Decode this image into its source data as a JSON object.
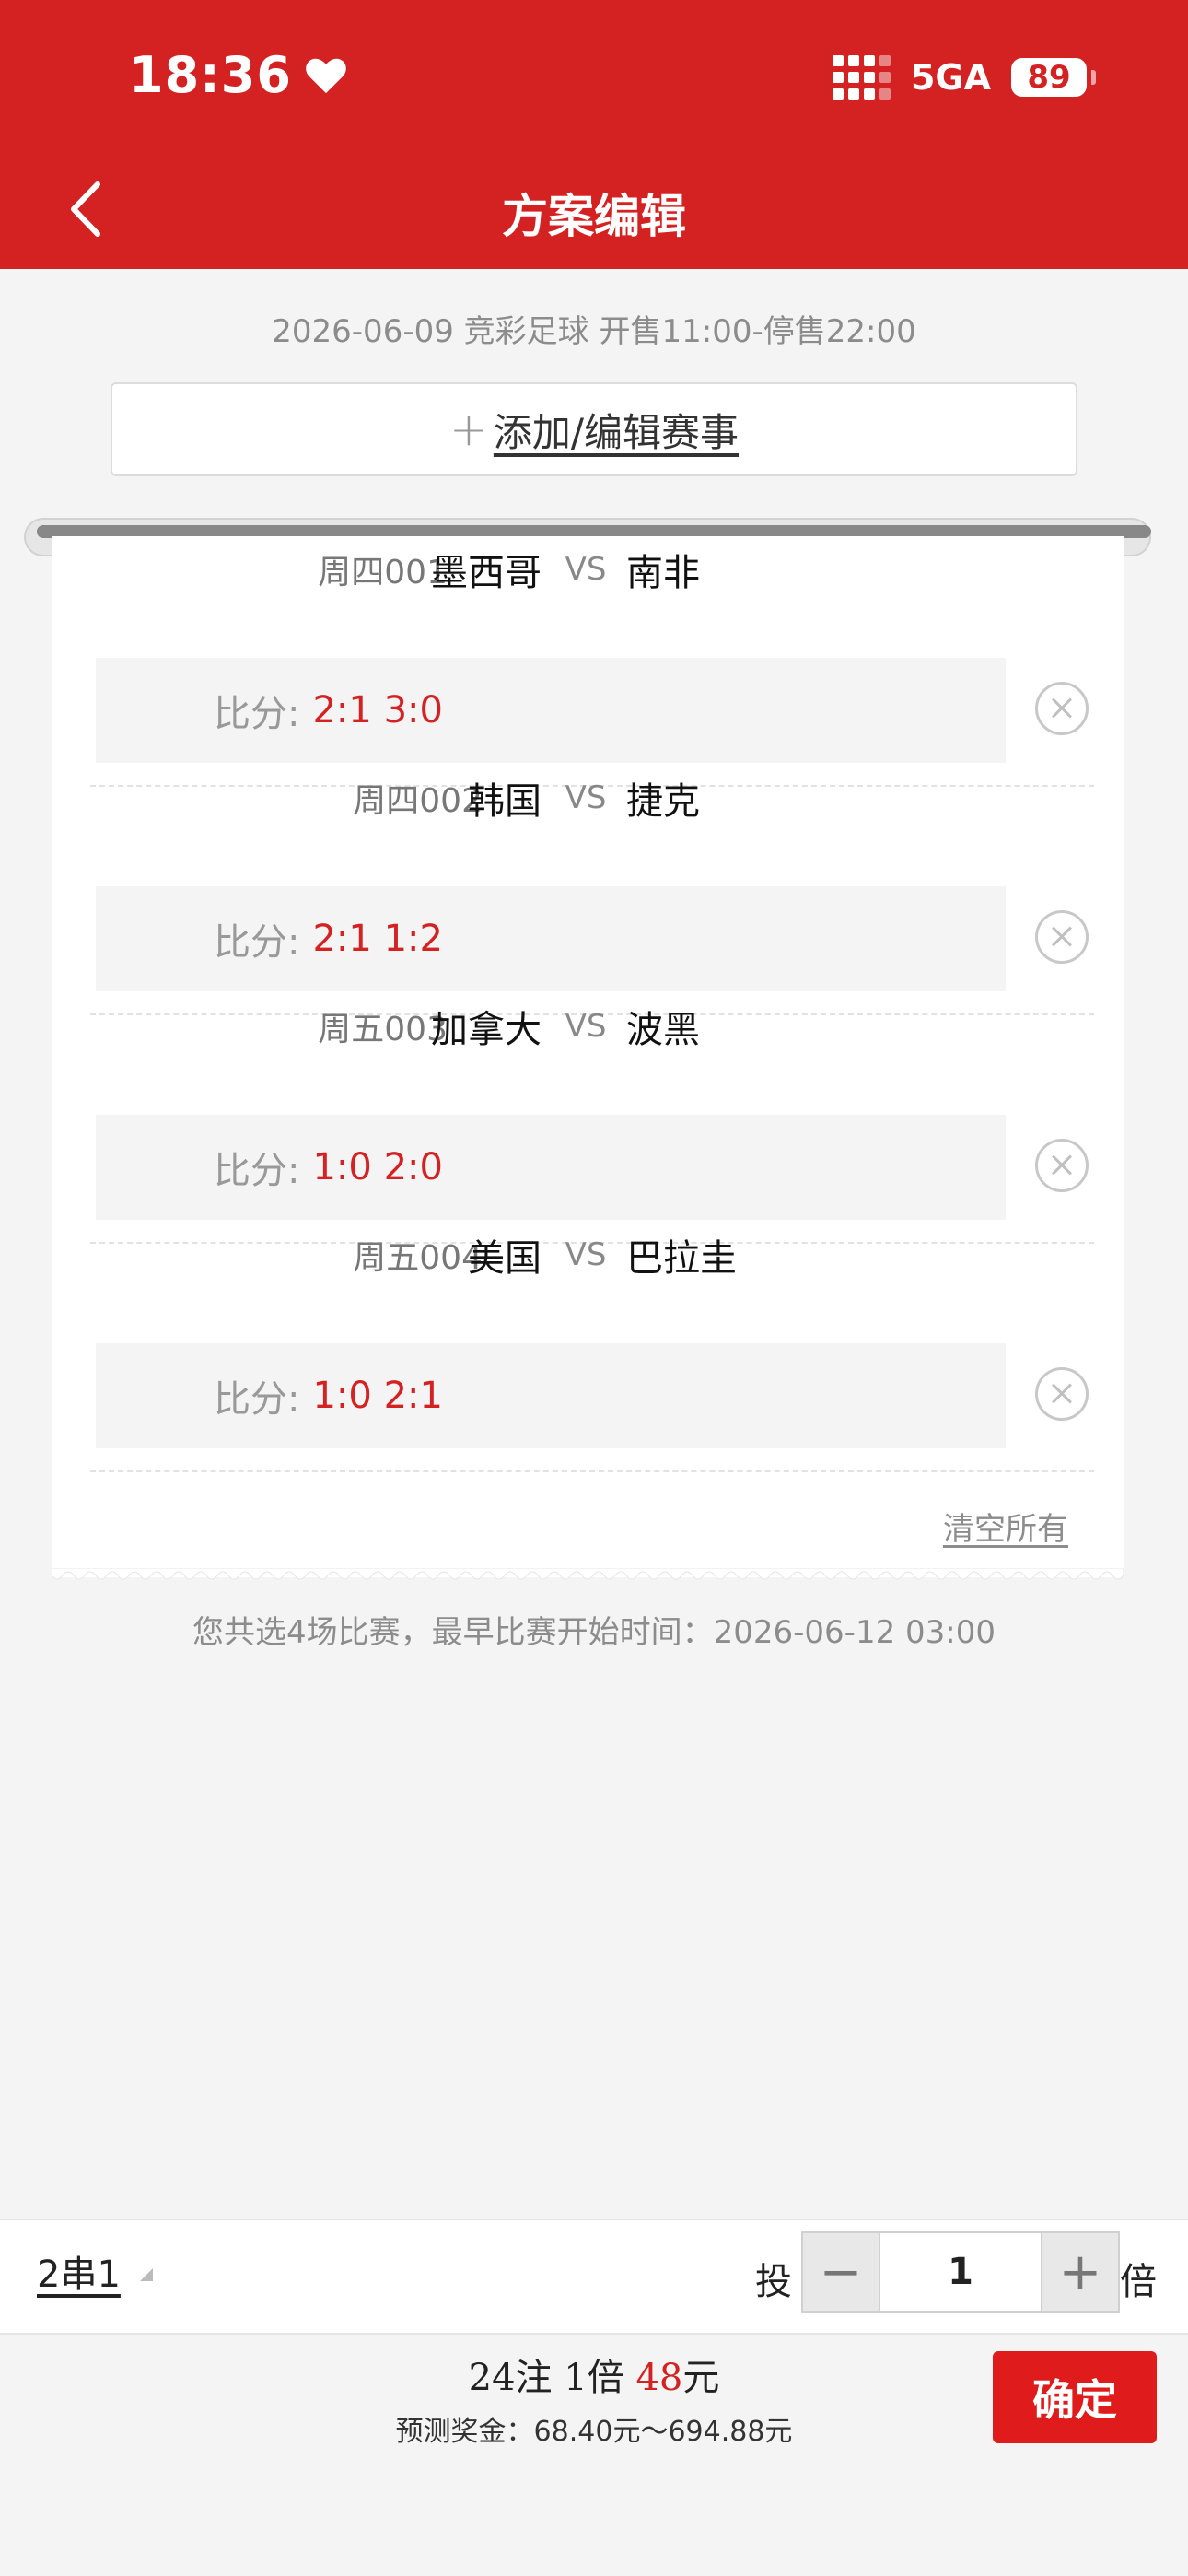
{
  "status_bar": {
    "time": "18:36",
    "network": "5GA",
    "battery": "89"
  },
  "header": {
    "title": "方案编辑"
  },
  "sale_info": "2026-06-09 竞彩足球 开售11:00-停售22:00",
  "add_button": {
    "plus": "+",
    "label": "添加/编辑赛事"
  },
  "matches": [
    {
      "code": "周四001",
      "home": "墨西哥",
      "vs": "VS",
      "away": "南非",
      "score_label": "比分:",
      "scores": "2:1 3:0"
    },
    {
      "code": "周四002",
      "home": "韩国",
      "vs": "VS",
      "away": "捷克",
      "score_label": "比分:",
      "scores": "2:1 1:2"
    },
    {
      "code": "周五003",
      "home": "加拿大",
      "vs": "VS",
      "away": "波黑",
      "score_label": "比分:",
      "scores": "1:0 2:0"
    },
    {
      "code": "周五004",
      "home": "美国",
      "vs": "VS",
      "away": "巴拉圭",
      "score_label": "比分:",
      "scores": "1:0 2:1"
    }
  ],
  "clear_all": "清空所有",
  "summary": "您共选4场比赛，最早比赛开始时间：2026-06-12 03:00",
  "footer": {
    "pass_type": "2串1",
    "tou": "投",
    "multiplier": "1",
    "minus": "−",
    "plus": "+",
    "bei": "倍",
    "bet_count": "24注 1倍 ",
    "bet_amount": "48",
    "bet_unit": "元",
    "prize": "预测奖金：68.40元～694.88元",
    "confirm": "确定"
  },
  "colors": {
    "brand_red": "#d42223",
    "score_red": "#d42223"
  }
}
